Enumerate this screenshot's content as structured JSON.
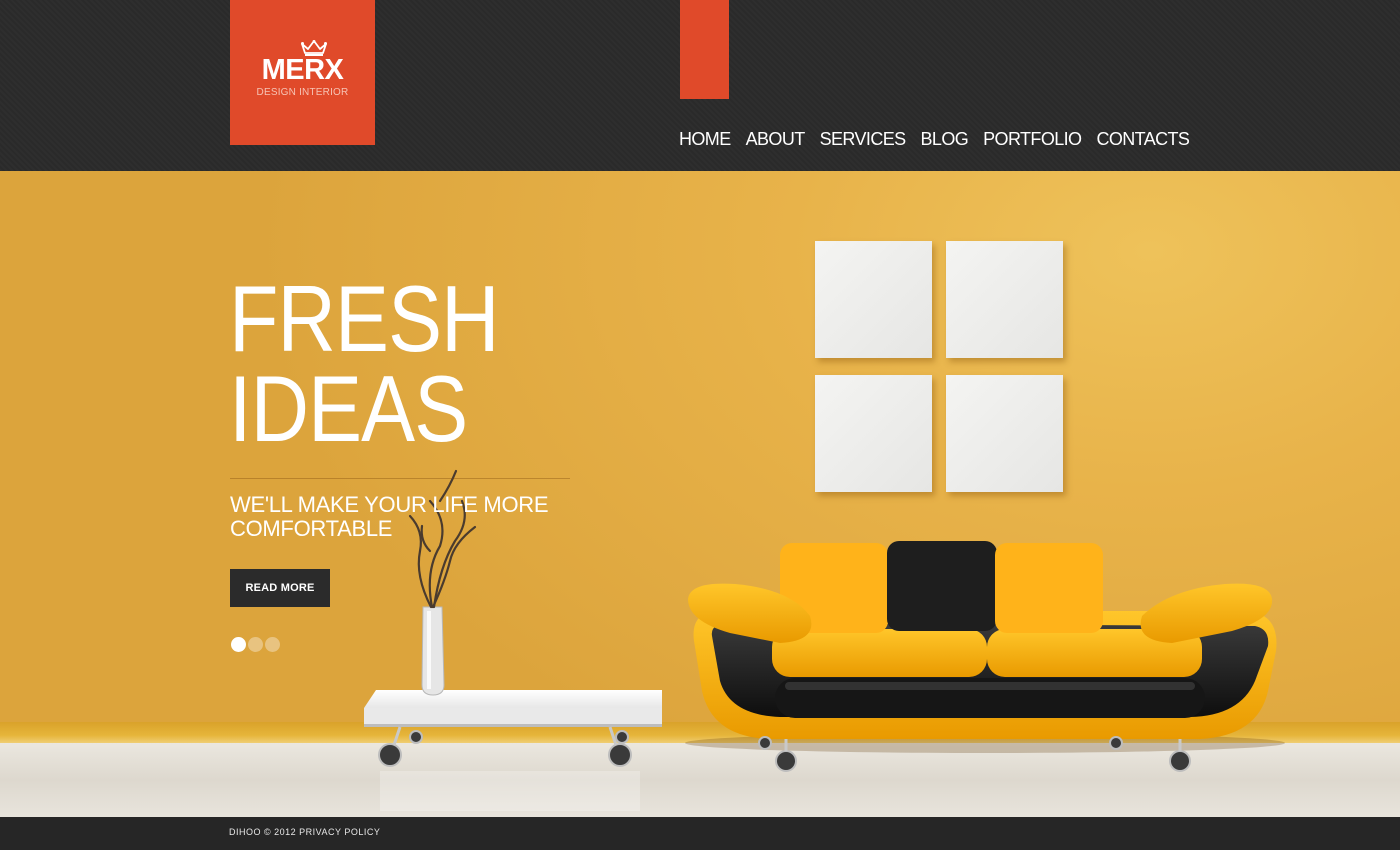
{
  "brand": {
    "name": "MERX",
    "tagline": "DESIGN INTERIOR",
    "icon": "crown-icon",
    "accent_color": "#e04a2a"
  },
  "nav": {
    "items": [
      {
        "label": "HOME"
      },
      {
        "label": "ABOUT"
      },
      {
        "label": "SERVICES"
      },
      {
        "label": "BLOG"
      },
      {
        "label": "PORTFOLIO"
      },
      {
        "label": "CONTACTS"
      }
    ]
  },
  "hero": {
    "title_line1": "FRESH",
    "title_line2": "IDEAS",
    "subtitle": "WE'LL MAKE YOUR LIFE MORE COMFORTABLE",
    "button_label": "READ MORE",
    "slides_total": 3,
    "slide_active": 1,
    "background_color": "#e8b34a"
  },
  "footer": {
    "copyright": "DIHOO © 2012",
    "privacy_link": "PRIVACY POLICY"
  }
}
